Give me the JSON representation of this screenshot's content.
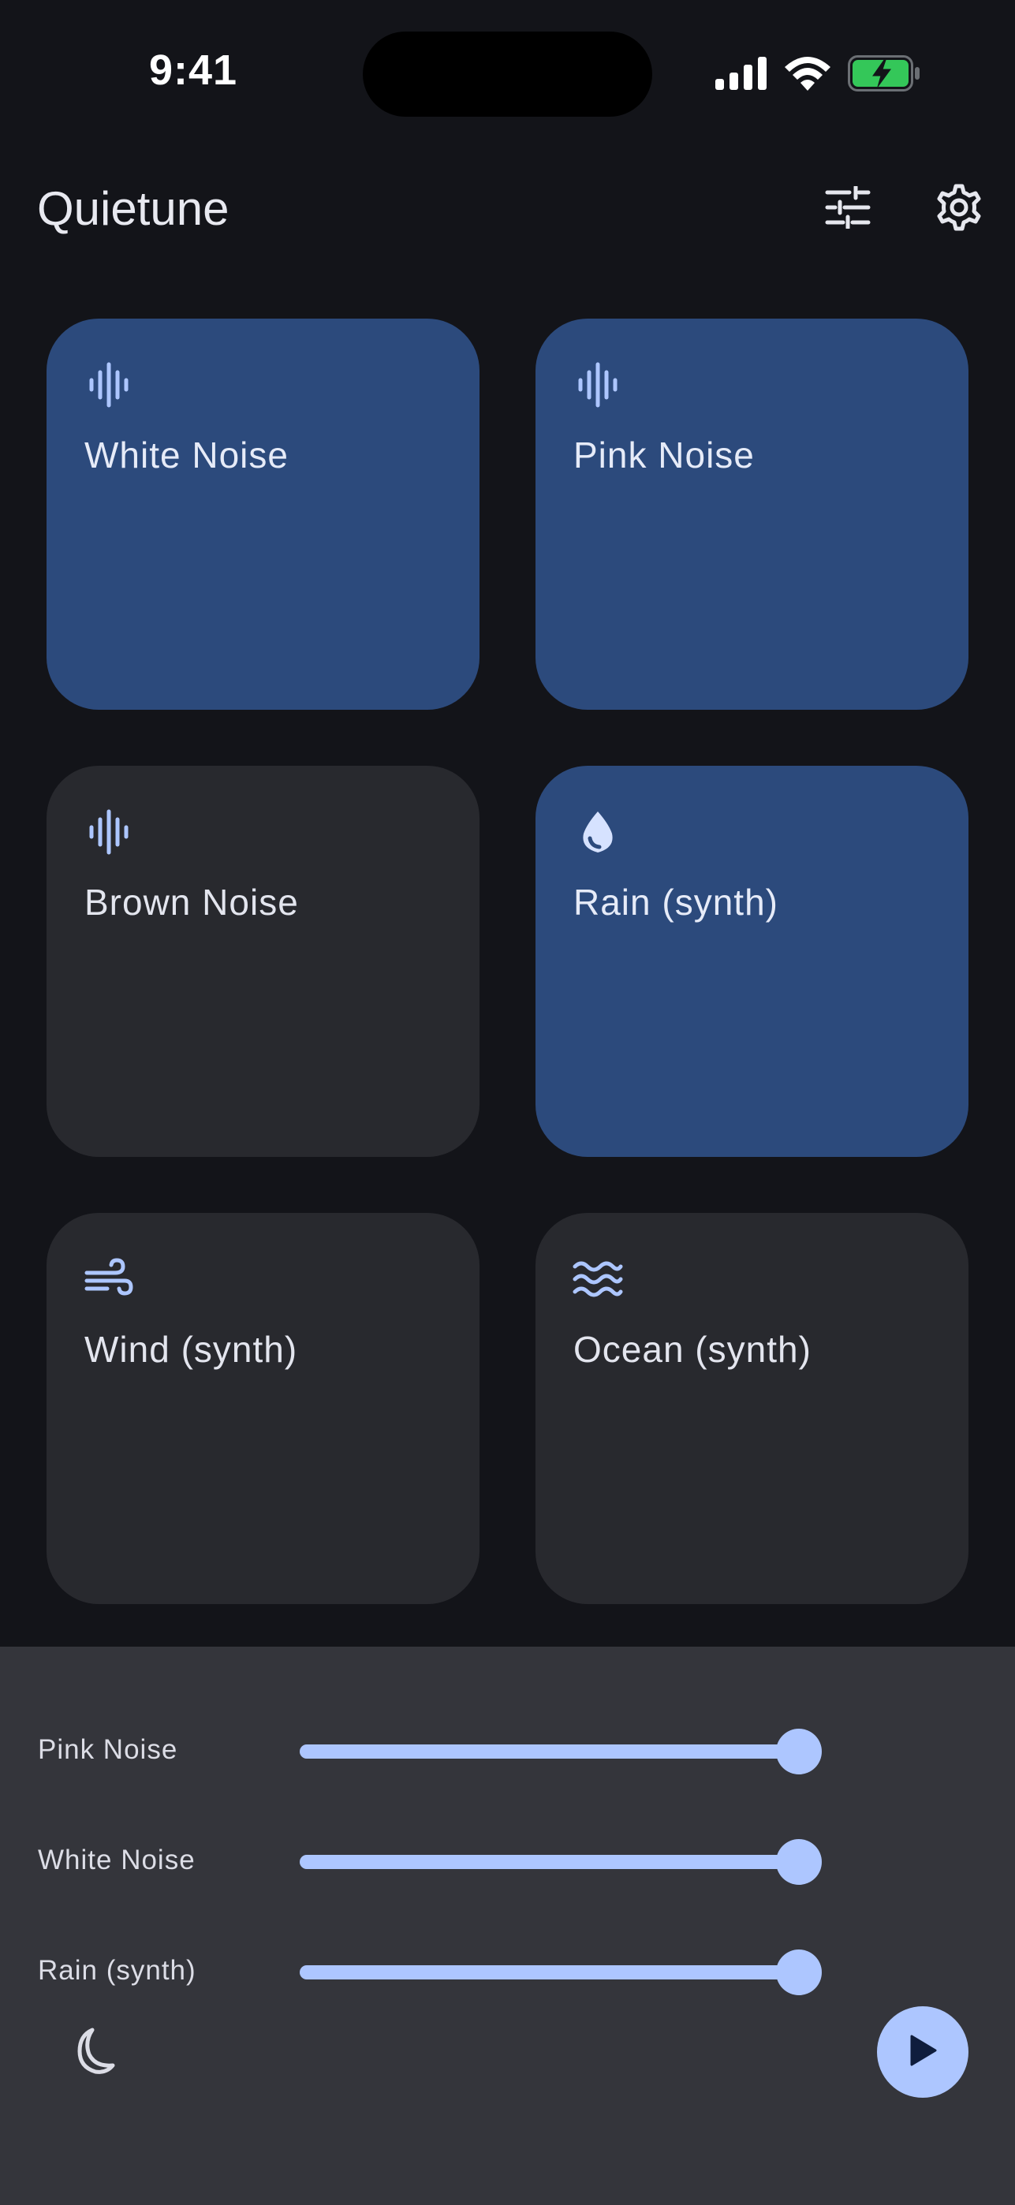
{
  "status_bar": {
    "time": "9:41",
    "icons": [
      "cellular-signal-icon",
      "wifi-icon",
      "battery-charging-icon"
    ]
  },
  "app": {
    "title": "Quietune",
    "actions": [
      {
        "icon": "tune-sliders-icon"
      },
      {
        "icon": "gear-icon"
      }
    ]
  },
  "sounds": [
    {
      "label": "White Noise",
      "icon": "waveform-icon",
      "active": true
    },
    {
      "label": "Pink Noise",
      "icon": "waveform-icon",
      "active": true
    },
    {
      "label": "Brown Noise",
      "icon": "waveform-icon",
      "active": false
    },
    {
      "label": "Rain (synth)",
      "icon": "water-drop-icon",
      "active": true
    },
    {
      "label": "Wind (synth)",
      "icon": "wind-icon",
      "active": false
    },
    {
      "label": "Ocean (synth)",
      "icon": "waves-icon",
      "active": false
    }
  ],
  "mixer": {
    "channels": [
      {
        "label": "Pink Noise",
        "volume": 1.0
      },
      {
        "label": "White Noise",
        "volume": 1.0
      },
      {
        "label": "Rain (synth)",
        "volume": 1.0
      }
    ],
    "sleep_icon": "moon-icon",
    "play_icon": "play-icon"
  },
  "colors": {
    "background": "#131419",
    "card_inactive": "#28292e",
    "card_active": "#2c4a7c",
    "accent": "#adc6ff",
    "panel": "#34353b",
    "battery_green": "#34c759"
  }
}
